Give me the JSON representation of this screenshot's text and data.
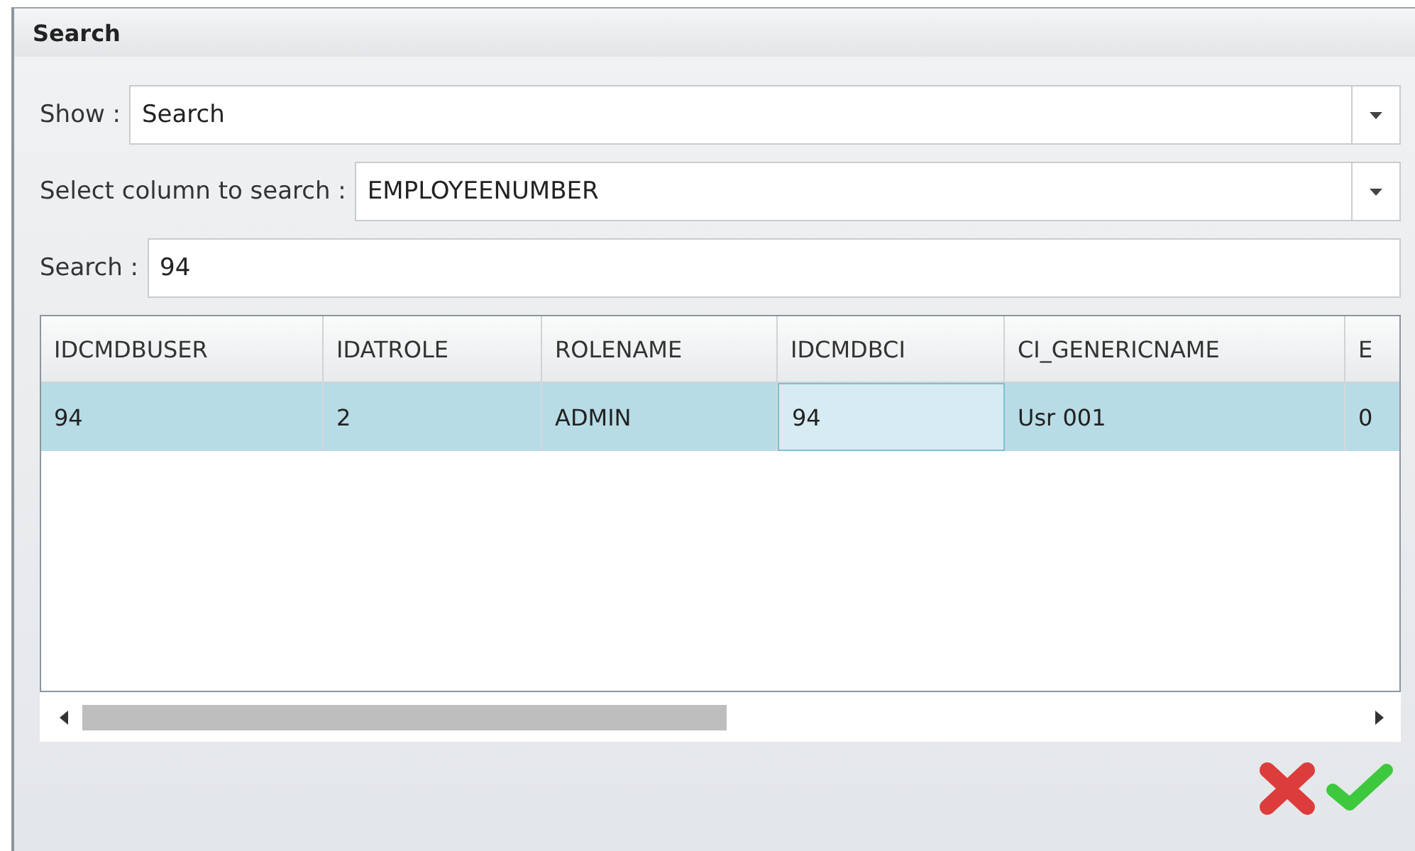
{
  "window": {
    "title": "Search"
  },
  "fields": [
    {
      "kind": "dropdown",
      "label": "Show :",
      "value": "Search"
    },
    {
      "kind": "dropdown",
      "label": "Select column to search :",
      "value": "EMPLOYEENUMBER"
    },
    {
      "kind": "text",
      "label": "Search :",
      "value": "94"
    }
  ],
  "table": {
    "columns": [
      "IDCMDBUSER",
      "IDATROLE",
      "ROLENAME",
      "IDCMDBCI",
      "CI_GENERICNAME",
      "E"
    ],
    "rows": [
      {
        "selected": true,
        "cells": [
          {
            "text": "94",
            "focused": false
          },
          {
            "text": "2",
            "focused": false
          },
          {
            "text": "ADMIN",
            "focused": false
          },
          {
            "text": "94",
            "focused": true
          },
          {
            "text": "Usr 001",
            "focused": false
          },
          {
            "text": "0",
            "focused": false
          }
        ]
      }
    ]
  },
  "buttons": [
    {
      "kind": "cancel"
    },
    {
      "kind": "confirm"
    }
  ]
}
